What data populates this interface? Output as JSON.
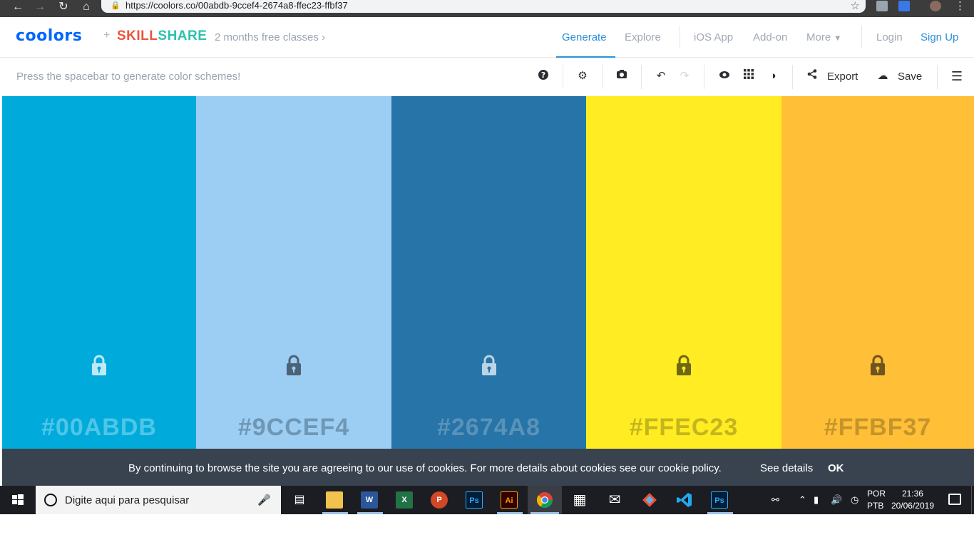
{
  "browser": {
    "url": "https://coolors.co/00abdb-9ccef4-2674a8-ffec23-ffbf37",
    "back_icon": "arrow-left",
    "forward_icon": "arrow-right",
    "reload_icon": "reload",
    "home_icon": "home",
    "lock_icon": "lock",
    "star_icon": "star"
  },
  "header": {
    "logo": "coolors",
    "plus": "+",
    "skillshare_a": "SKILL",
    "skillshare_b": "SHARE",
    "promo": "2 months free classes",
    "nav": {
      "generate": "Generate",
      "explore": "Explore",
      "ios_app": "iOS App",
      "add_on": "Add-on",
      "more": "More",
      "login": "Login",
      "signup": "Sign Up"
    }
  },
  "toolbar": {
    "hint": "Press the spacebar to generate color schemes!",
    "export": "Export",
    "save": "Save"
  },
  "palette": [
    {
      "hex": "#00ABDB",
      "color": "#00abdb",
      "text_color": "#4fc6e8",
      "lock_color": "#bfe9f6"
    },
    {
      "hex": "#9CCEF4",
      "color": "#9ccef4",
      "text_color": "#6f97b4",
      "lock_color": "#4c6376"
    },
    {
      "hex": "#2674A8",
      "color": "#2674a8",
      "text_color": "#5b92b8",
      "lock_color": "#bcd5e6"
    },
    {
      "hex": "#FFEC23",
      "color": "#ffec23",
      "text_color": "#c5b51c",
      "lock_color": "#6e6714"
    },
    {
      "hex": "#FFBF37",
      "color": "#ffbf37",
      "text_color": "#c6942c",
      "lock_color": "#6e5520"
    }
  ],
  "cookie": {
    "message": "By continuing to browse the site you are agreeing to our use of cookies. For more details about cookies see our cookie policy.",
    "details": "See details",
    "ok": "OK"
  },
  "taskbar": {
    "search_placeholder": "Digite aqui para pesquisar",
    "lang_top": "POR",
    "lang_bottom": "PTB",
    "time": "21:36",
    "date": "20/06/2019",
    "apps": [
      {
        "name": "task-view",
        "label": ""
      },
      {
        "name": "file-explorer",
        "label": ""
      },
      {
        "name": "word",
        "label": "W"
      },
      {
        "name": "excel",
        "label": "X"
      },
      {
        "name": "powerpoint",
        "label": "P"
      },
      {
        "name": "photoshop",
        "label": "Ps"
      },
      {
        "name": "illustrator",
        "label": "Ai"
      },
      {
        "name": "chrome",
        "label": ""
      },
      {
        "name": "calculator",
        "label": ""
      },
      {
        "name": "mail",
        "label": ""
      },
      {
        "name": "git",
        "label": ""
      },
      {
        "name": "vscode",
        "label": ""
      },
      {
        "name": "photoshop-2",
        "label": "Ps"
      }
    ]
  }
}
